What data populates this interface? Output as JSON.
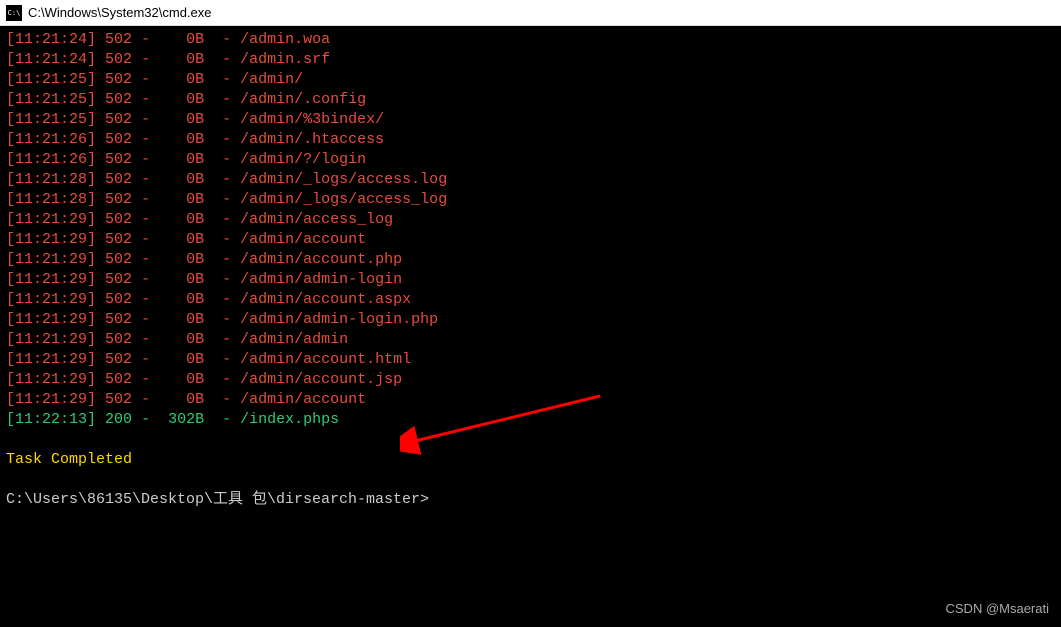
{
  "window": {
    "title": "C:\\Windows\\System32\\cmd.exe"
  },
  "log_lines": [
    {
      "time": "[11:21:24]",
      "code": "502",
      "dash1": "-",
      "size": "   0B",
      "dash2": "-",
      "path": "/admin.woa",
      "class": "red"
    },
    {
      "time": "[11:21:24]",
      "code": "502",
      "dash1": "-",
      "size": "   0B",
      "dash2": "-",
      "path": "/admin.srf",
      "class": "red"
    },
    {
      "time": "[11:21:25]",
      "code": "502",
      "dash1": "-",
      "size": "   0B",
      "dash2": "-",
      "path": "/admin/",
      "class": "red"
    },
    {
      "time": "[11:21:25]",
      "code": "502",
      "dash1": "-",
      "size": "   0B",
      "dash2": "-",
      "path": "/admin/.config",
      "class": "red"
    },
    {
      "time": "[11:21:25]",
      "code": "502",
      "dash1": "-",
      "size": "   0B",
      "dash2": "-",
      "path": "/admin/%3bindex/",
      "class": "red"
    },
    {
      "time": "[11:21:26]",
      "code": "502",
      "dash1": "-",
      "size": "   0B",
      "dash2": "-",
      "path": "/admin/.htaccess",
      "class": "red"
    },
    {
      "time": "[11:21:26]",
      "code": "502",
      "dash1": "-",
      "size": "   0B",
      "dash2": "-",
      "path": "/admin/?/login",
      "class": "red"
    },
    {
      "time": "[11:21:28]",
      "code": "502",
      "dash1": "-",
      "size": "   0B",
      "dash2": "-",
      "path": "/admin/_logs/access.log",
      "class": "red"
    },
    {
      "time": "[11:21:28]",
      "code": "502",
      "dash1": "-",
      "size": "   0B",
      "dash2": "-",
      "path": "/admin/_logs/access_log",
      "class": "red"
    },
    {
      "time": "[11:21:29]",
      "code": "502",
      "dash1": "-",
      "size": "   0B",
      "dash2": "-",
      "path": "/admin/access_log",
      "class": "red"
    },
    {
      "time": "[11:21:29]",
      "code": "502",
      "dash1": "-",
      "size": "   0B",
      "dash2": "-",
      "path": "/admin/account",
      "class": "red"
    },
    {
      "time": "[11:21:29]",
      "code": "502",
      "dash1": "-",
      "size": "   0B",
      "dash2": "-",
      "path": "/admin/account.php",
      "class": "red"
    },
    {
      "time": "[11:21:29]",
      "code": "502",
      "dash1": "-",
      "size": "   0B",
      "dash2": "-",
      "path": "/admin/admin-login",
      "class": "red"
    },
    {
      "time": "[11:21:29]",
      "code": "502",
      "dash1": "-",
      "size": "   0B",
      "dash2": "-",
      "path": "/admin/account.aspx",
      "class": "red"
    },
    {
      "time": "[11:21:29]",
      "code": "502",
      "dash1": "-",
      "size": "   0B",
      "dash2": "-",
      "path": "/admin/admin-login.php",
      "class": "red"
    },
    {
      "time": "[11:21:29]",
      "code": "502",
      "dash1": "-",
      "size": "   0B",
      "dash2": "-",
      "path": "/admin/admin",
      "class": "red"
    },
    {
      "time": "[11:21:29]",
      "code": "502",
      "dash1": "-",
      "size": "   0B",
      "dash2": "-",
      "path": "/admin/account.html",
      "class": "red"
    },
    {
      "time": "[11:21:29]",
      "code": "502",
      "dash1": "-",
      "size": "   0B",
      "dash2": "-",
      "path": "/admin/account.jsp",
      "class": "red"
    },
    {
      "time": "[11:21:29]",
      "code": "502",
      "dash1": "-",
      "size": "   0B",
      "dash2": "-",
      "path": "/admin/account",
      "class": "red"
    },
    {
      "time": "[11:22:13]",
      "code": "200",
      "dash1": "-",
      "size": " 302B",
      "dash2": "-",
      "path": "/index.phps",
      "class": "green"
    }
  ],
  "task_completed": "Task Completed",
  "prompt": "C:\\Users\\86135\\Desktop\\工具 包\\dirsearch-master>",
  "watermark": "CSDN @Msaerati"
}
